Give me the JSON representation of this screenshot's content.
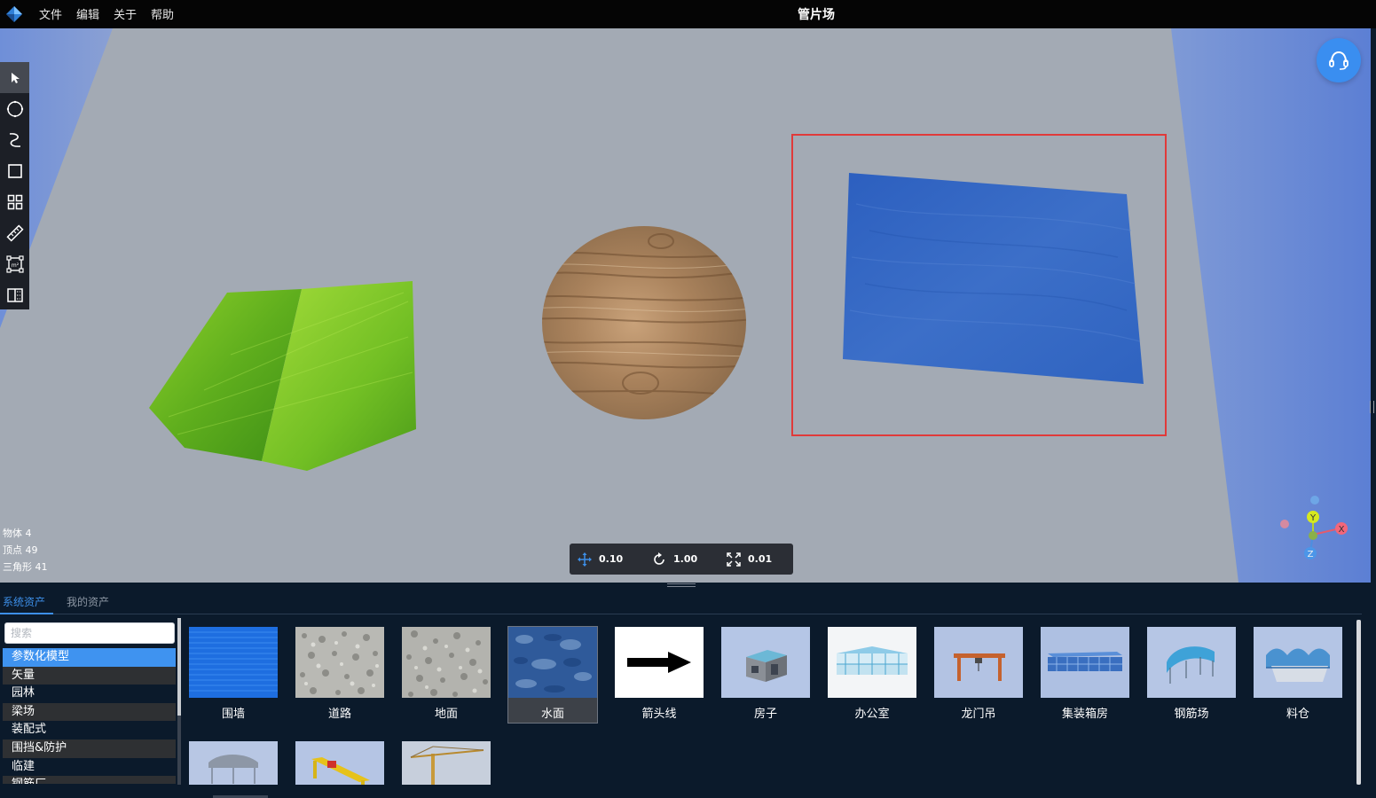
{
  "menu": {
    "items": [
      "文件",
      "编辑",
      "关于",
      "帮助"
    ],
    "title": "管片场"
  },
  "toolbar": {
    "tools": [
      "select-arrow-icon",
      "circle-draw-icon",
      "freehand-curve-icon",
      "rectangle-draw-icon",
      "grid-layout-icon",
      "ruler-measure-icon",
      "area-measure-icon",
      "split-view-icon"
    ],
    "active_index": 0
  },
  "viewport": {
    "background_color": "#a3aab4",
    "objects": [
      "grass-polygon",
      "wood-circle",
      "water-rectangle"
    ],
    "selection_color": "#e03a3a"
  },
  "stats": {
    "objects": "物体 4",
    "vertices": "顶点 49",
    "triangles": "三角形 41"
  },
  "transform": {
    "move": "0.10",
    "rotate": "1.00",
    "scale": "0.01"
  },
  "gizmo": {
    "x_label": "X",
    "y_label": "Y",
    "z_label": "Z"
  },
  "assets_panel": {
    "tabs": [
      "系统资产",
      "我的资产"
    ],
    "active_tab": 0,
    "search_placeholder": "搜索",
    "categories": [
      "参数化模型",
      "矢量",
      "园林",
      "梁场",
      "装配式",
      "围挡&防护",
      "临建",
      "钢筋厂"
    ],
    "selected_category": 0,
    "assets": [
      {
        "label": "围墙",
        "icon": "blue-panel-wall"
      },
      {
        "label": "道路",
        "icon": "gravel-road-texture"
      },
      {
        "label": "地面",
        "icon": "gravel-ground-texture"
      },
      {
        "label": "水面",
        "icon": "water-texture"
      },
      {
        "label": "箭头线",
        "icon": "arrow-line"
      },
      {
        "label": "房子",
        "icon": "house-model"
      },
      {
        "label": "办公室",
        "icon": "office-model"
      },
      {
        "label": "龙门吊",
        "icon": "gantry-crane-model"
      },
      {
        "label": "集装箱房",
        "icon": "container-house-model"
      },
      {
        "label": "钢筋场",
        "icon": "rebar-yard-model"
      },
      {
        "label": "料仓",
        "icon": "material-silo-model"
      },
      {
        "label": "",
        "icon": "shed-model"
      },
      {
        "label": "",
        "icon": "bridge-crane-model"
      },
      {
        "label": "",
        "icon": "tower-crane-model"
      }
    ],
    "selected_asset": 3
  },
  "colors": {
    "accent": "#3d8fe8",
    "menu_bg": "#050505",
    "panel_bg": "#0b1a2b",
    "support_button": "#3a8ef0"
  }
}
